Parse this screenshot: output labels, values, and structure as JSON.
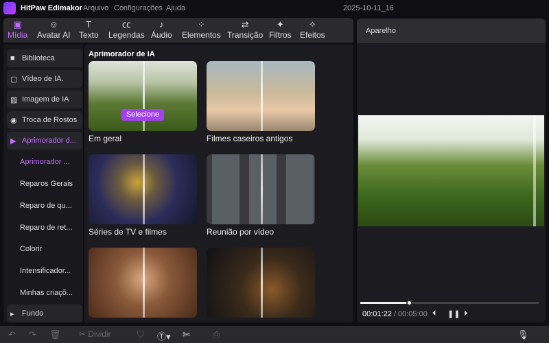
{
  "titlebar": {
    "app_name": "HitPaw Edimakor",
    "menus": [
      "Arquivo",
      "Configurações",
      "Ajuda"
    ],
    "project": "2025-10-11_16"
  },
  "tabs": [
    {
      "label": "Mídia",
      "icon": "media-icon"
    },
    {
      "label": "Avatar AI",
      "icon": "avatar-icon"
    },
    {
      "label": "Texto",
      "icon": "text-icon"
    },
    {
      "label": "Legendas",
      "icon": "captions-icon"
    },
    {
      "label": "Áudio",
      "icon": "music-icon"
    },
    {
      "label": "Elementos",
      "icon": "elements-icon"
    },
    {
      "label": "Transição",
      "icon": "transition-icon"
    },
    {
      "label": "Filtros",
      "icon": "filters-icon"
    },
    {
      "label": "Efeitos",
      "icon": "effects-icon"
    }
  ],
  "sidebar": {
    "items": [
      {
        "label": "Biblioteca",
        "icon": "folder-icon"
      },
      {
        "label": "Vídeo de IA.",
        "icon": "ai-video-icon"
      },
      {
        "label": "Imagem de IA",
        "icon": "ai-image-icon"
      },
      {
        "label": "Troca de Rostos",
        "icon": "face-swap-icon"
      },
      {
        "label": "Aprimorador d...",
        "icon": "enhancer-icon"
      }
    ],
    "subitems": [
      "Aprimorador ...",
      "Reparos Gerais",
      "Reparo de qu...",
      "Reparo de ret...",
      "Colorir",
      "Intensificador...",
      "Minhas criaçõ..."
    ],
    "fundo": "Fundo"
  },
  "content": {
    "title": "Aprimorador de IA",
    "select_label": "Selecione",
    "cards": [
      {
        "label": "Em geral"
      },
      {
        "label": "Filmes caseiros antigos"
      },
      {
        "label": "Séries de TV e filmes"
      },
      {
        "label": "Reunião por vídeo"
      }
    ]
  },
  "preview": {
    "title": "Aparelho",
    "current_time": "00:01:22",
    "separator": " / ",
    "duration": "00:05:00",
    "progress": 0.273
  },
  "toolbar": {
    "split_label": "Dividir"
  },
  "colors": {
    "accent": "#c46cff",
    "button": "#a23ff0"
  }
}
